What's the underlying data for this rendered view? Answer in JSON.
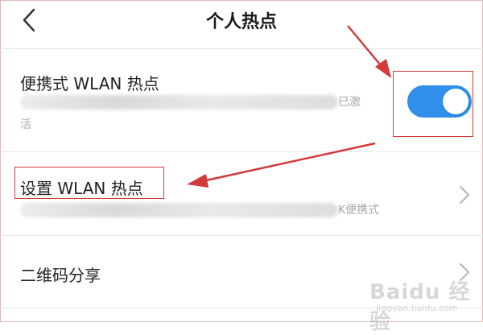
{
  "header": {
    "title": "个人热点",
    "back_icon": "chevron-left-icon"
  },
  "hotspot": {
    "title": "便携式 WLAN 热点",
    "desc_tail": "已激",
    "desc_line2": "活",
    "toggle_on": true
  },
  "settings": {
    "title": "设置 WLAN 热点",
    "desc_tail": "K便携式"
  },
  "qr": {
    "title": "二维码分享"
  },
  "watermark": {
    "brand": "Baidu 经验",
    "url": "jingyan.baidu.com"
  },
  "colors": {
    "toggle_on": "#2f8fe9",
    "annotation": "#d33a3a",
    "divider": "#e6e6e6"
  }
}
